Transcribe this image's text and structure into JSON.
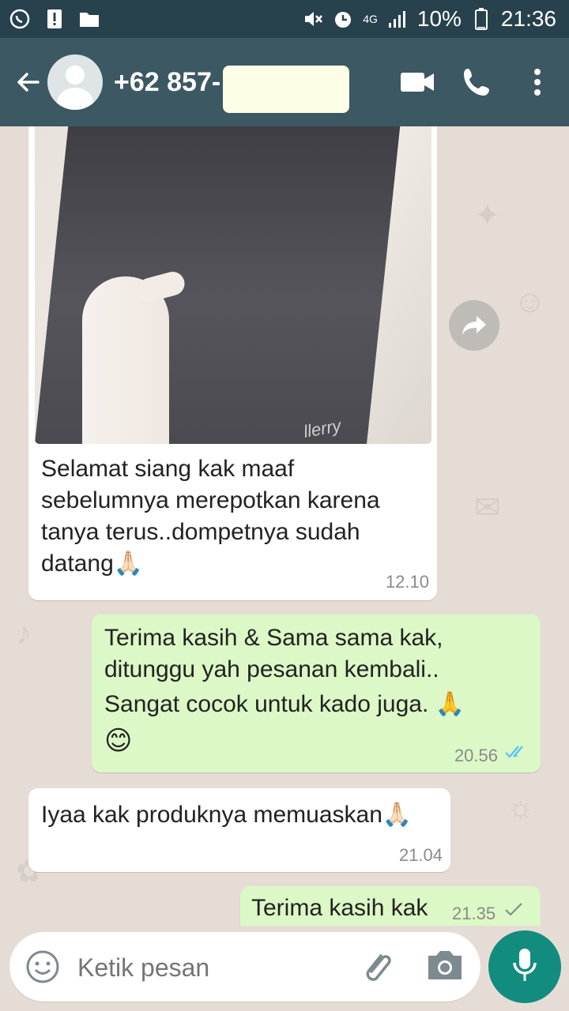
{
  "statusbar": {
    "network": "4G",
    "battery_percent": "10%",
    "time": "21:36"
  },
  "header": {
    "contact": "+62 857-",
    "icons": [
      "back-arrow-icon",
      "avatar",
      "video-call-icon",
      "phone-icon",
      "more-vert-icon"
    ]
  },
  "messages": [
    {
      "direction": "incoming",
      "has_image": true,
      "image_text": "llerry",
      "text": "Selamat siang kak maaf sebelumnya merepotkan karena tanya terus..dompetnya sudah datang🙏🏻",
      "lines": [
        "Selamat siang kak maaf",
        "sebelumnya merepotkan karena",
        "tanya terus..dompetnya sudah",
        "datang🙏🏻"
      ],
      "time": "12.10"
    },
    {
      "direction": "outgoing",
      "lines": [
        "Terima kasih & Sama sama kak,",
        "ditunggu yah pesanan kembali..",
        "Sangat cocok untuk kado juga. 🙏",
        "😊"
      ],
      "time": "20.56",
      "status": "read"
    },
    {
      "direction": "incoming",
      "lines": [
        "Iyaa kak produknya memuaskan🙏🏻"
      ],
      "time": "21.04"
    },
    {
      "direction": "outgoing",
      "lines": [
        "Terima kasih kak"
      ],
      "time": "21.35",
      "status": "sent"
    }
  ],
  "input": {
    "placeholder": "Ketik pesan"
  },
  "colors": {
    "statusbar": "#27424d",
    "appbar": "#3c5862",
    "incoming": "#ffffff",
    "outgoing": "#dcf8c6",
    "mic": "#128c7e",
    "read_ticks": "#4fc3f7"
  }
}
